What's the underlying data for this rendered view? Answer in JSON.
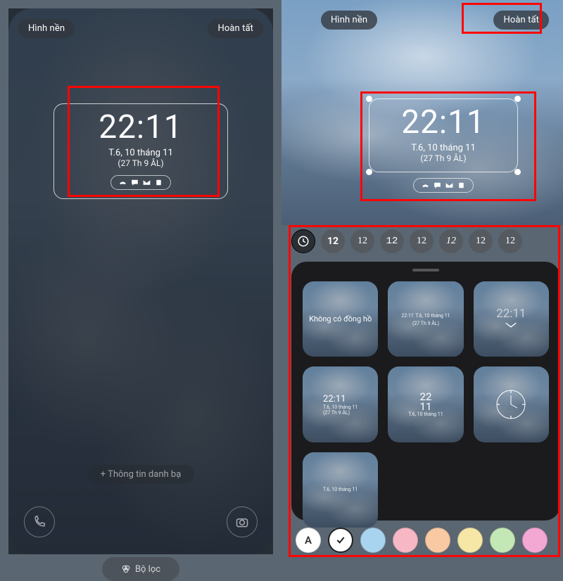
{
  "buttons": {
    "wallpaper": "Hình nền",
    "done": "Hoàn tất",
    "filter": "Bộ lọc",
    "contact": "+  Thông tin danh bạ"
  },
  "clock": {
    "time": "22:11",
    "date": "T.6, 10 tháng 11",
    "lunar": "(27 Th 9 ÂL)"
  },
  "font_options": [
    "analog",
    "12",
    "12",
    "12",
    "12",
    "12",
    "12",
    "12"
  ],
  "styles": {
    "none": "Không có đồng hồ",
    "tile2": {
      "time": "22:11",
      "date": "T.6, 10 tháng 11",
      "lunar": "(27 Th 9 ÂL)"
    },
    "tile3": {
      "time": "22:11"
    },
    "tile4": {
      "time": "22:11",
      "date": "T.6, 10 tháng 11",
      "lunar": "(27 Th 9 ÂL)"
    },
    "tile5": {
      "time_top": "22",
      "time_bot": "11",
      "date": "T.6, 10 tháng 11"
    },
    "tile7": {
      "date": "T.6, 10 tháng 11"
    }
  },
  "colors": {
    "auto": "A",
    "list": [
      "#ffffff",
      "#a9d4ef",
      "#f7b7c4",
      "#f9c9a3",
      "#f6e7a6",
      "#c3e8b5",
      "#f3a8d3"
    ]
  }
}
